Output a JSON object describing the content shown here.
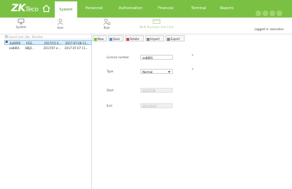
{
  "brand": {
    "logo_main": "ZK",
    "logo_tail": "Teco"
  },
  "nav": {
    "tabs": [
      {
        "label": "System",
        "active": true
      },
      {
        "label": "Personnel",
        "active": false
      },
      {
        "label": "Authorization",
        "active": false
      },
      {
        "label": "Financial",
        "active": false
      },
      {
        "label": "Terminal",
        "active": false
      },
      {
        "label": "Reports",
        "active": false
      }
    ]
  },
  "subbar": {
    "items": [
      {
        "label": "System",
        "icon": "monitor-icon"
      },
      {
        "label": "User",
        "icon": "user-icon"
      },
      {
        "label": "Role",
        "icon": "role-icon"
      },
      {
        "label": "Multi Business Unit Card",
        "icon": "card-icon"
      }
    ],
    "logged_in": "Logged in: executive"
  },
  "search": {
    "placeholder": "Search bar, Bar, Number"
  },
  "list": {
    "rows": [
      {
        "c1": "ba6690",
        "c2": "VGS...",
        "c3": "2017/10 4...",
        "c4": "2017-07-08 11...",
        "selected": true
      },
      {
        "c1": "ee8801",
        "c2": "BBJ3...",
        "c3": "2017/07 e...",
        "c4": "2017-07-07 11...",
        "selected": false
      }
    ]
  },
  "toolbar": {
    "new": "New",
    "save": "Save",
    "delete": "Delete",
    "import": "Import",
    "export": "Export"
  },
  "form": {
    "license_label": "License number",
    "license_value": "ee8801",
    "type_label": "Type",
    "type_value": "Normal",
    "start_label": "Start",
    "start_value": "2017/7/8",
    "end_label": "End",
    "end_value": "2017/10/7",
    "required_mark": "*"
  },
  "colors": {
    "accent": "#7ac143",
    "selection": "#d8ecfa"
  }
}
